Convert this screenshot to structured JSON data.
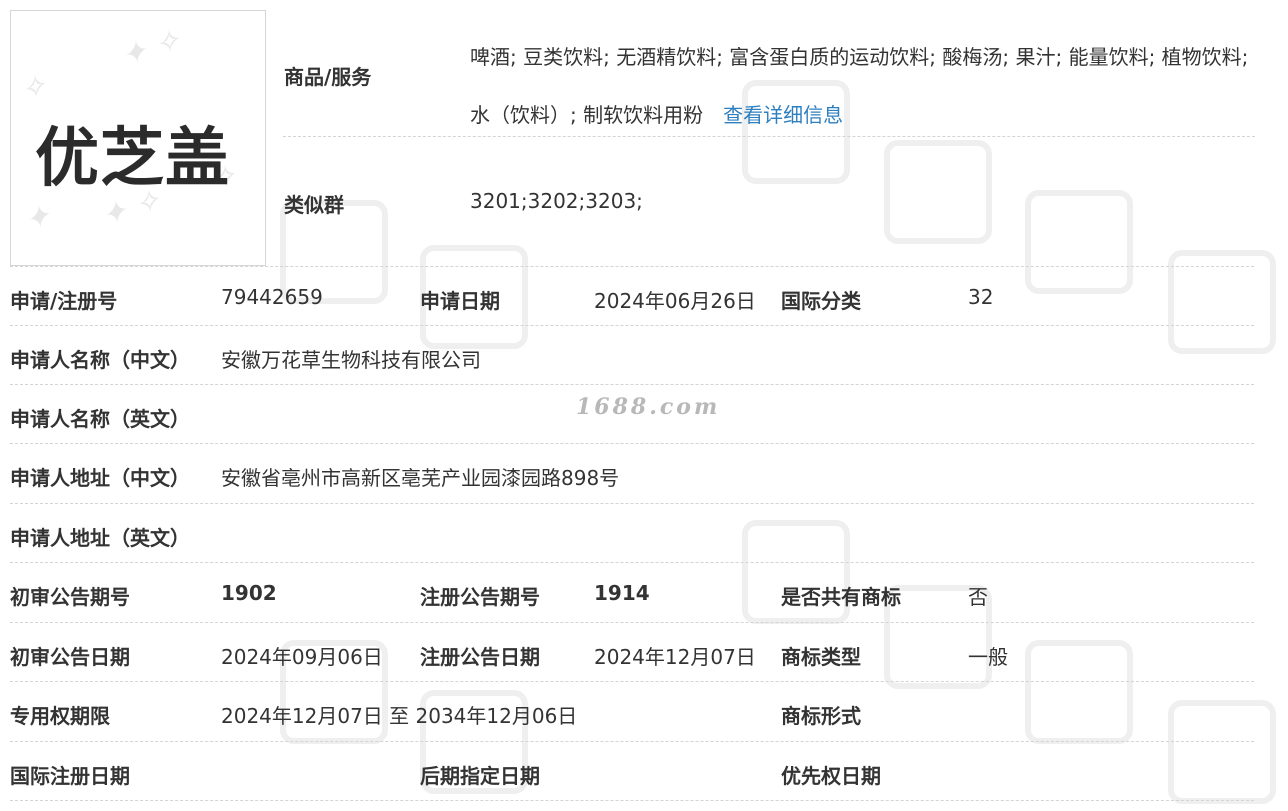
{
  "logo": {
    "mark_text": "优芝盖"
  },
  "goods": {
    "label": "商品/服务",
    "value": "啤酒; 豆类饮料; 无酒精饮料; 富含蛋白质的运动饮料; 酸梅汤; 果汁; 能量饮料; 植物饮料; 水（饮料）; 制软饮料用粉",
    "link": "查看详细信息"
  },
  "similar": {
    "label": "类似群",
    "value": "3201;3202;3203;"
  },
  "rows": [
    {
      "l1": "申请/注册号",
      "v1": "79442659",
      "l2": "申请日期",
      "v2": "2024年06月26日",
      "l3": "国际分类",
      "v3": "32"
    },
    {
      "l1": "申请人名称（中文）",
      "v1": "安徽万花草生物科技有限公司"
    },
    {
      "l1": "申请人名称（英文）",
      "v1": ""
    },
    {
      "l1": "申请人地址（中文）",
      "v1": "安徽省亳州市高新区亳芜产业园漆园路898号"
    },
    {
      "l1": "申请人地址（英文）",
      "v1": ""
    },
    {
      "l1": "初审公告期号",
      "v1": "1902",
      "l2": "注册公告期号",
      "v2": "1914",
      "l3": "是否共有商标",
      "v3": "否"
    },
    {
      "l1": "初审公告日期",
      "v1": "2024年09月06日",
      "l2": "注册公告日期",
      "v2": "2024年12月07日",
      "l3": "商标类型",
      "v3": "一般"
    },
    {
      "l1": "专用权期限",
      "v1": "2024年12月07日 至 2034年12月06日",
      "l2": "",
      "v2": "",
      "l3": "商标形式",
      "v3": ""
    },
    {
      "l1": "国际注册日期",
      "v1": "",
      "l2": "后期指定日期",
      "v2": "",
      "l3": "优先权日期",
      "v3": ""
    }
  ],
  "watermark": {
    "site": "1688.com"
  }
}
